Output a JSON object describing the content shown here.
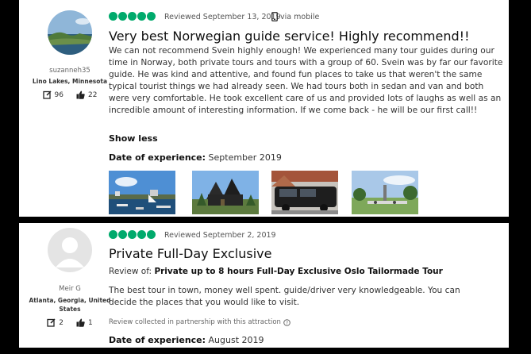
{
  "review1": {
    "username": "suzanneh35",
    "location": "Lino Lakes, Minnesota",
    "contributions": "96",
    "helpful_votes": "22",
    "rating": 5,
    "reviewed_date": "Reviewed September 13, 2019",
    "via": "via mobile",
    "title": "Very best Norwegian guide service! Highly recommend!!",
    "body": "We can not recommend Svein highly enough! We experienced many tour guides during our time in Norway, both private tours and tours with a group of 60. Svein was by far our favorite guide. He was kind and attentive, and found fun places to take us that weren't the same typical tourist things we had already seen. We had tours both in sedan and van and both were very comfortable. He took excellent care of us and provided lots of laughs as well as an incredible amount of interesting information. If we come back - he will be our first call!!",
    "show_less": "Show less",
    "date_label": "Date of experience:",
    "date_value": "September 2019",
    "photos": [
      "harbor-photo",
      "church-photo",
      "van-photo",
      "park-photo"
    ]
  },
  "review2": {
    "username": "Meir G",
    "location": "Atlanta, Georgia, United States",
    "contributions": "2",
    "helpful_votes": "1",
    "rating": 5,
    "reviewed_date": "Reviewed September 2, 2019",
    "title": "Private Full-Day Exclusive",
    "review_of_label": "Review of:",
    "review_of_value": "Private up to 8 hours Full-Day Exclusive Oslo Tailormade Tour",
    "body": "The best tour in town, money well spent. guide/driver very knowledgeable. You can decide the places that you would like to visit.",
    "collected": "Review collected in partnership with this attraction",
    "date_label": "Date of experience:",
    "date_value": "August 2019"
  },
  "colors": {
    "rating_green": "#00aa6c",
    "background": "#000000"
  }
}
